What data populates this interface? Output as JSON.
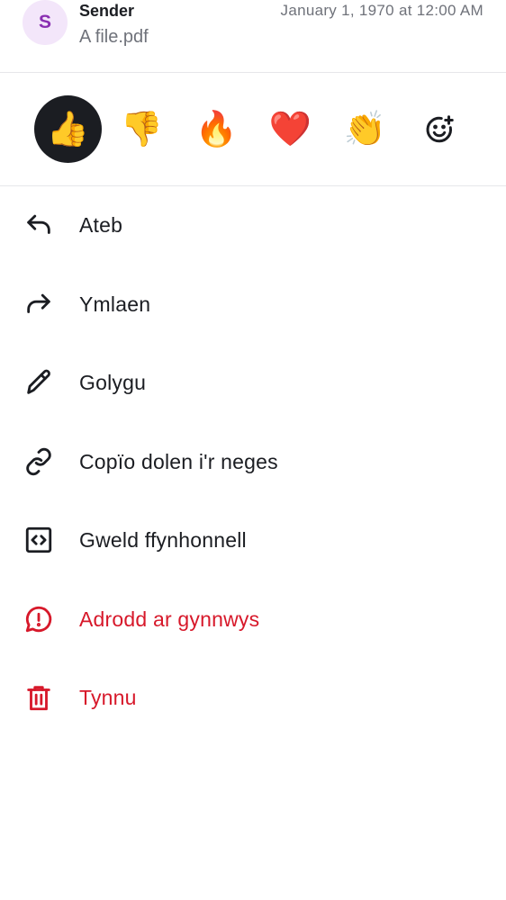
{
  "header": {
    "avatar_initial": "S",
    "sender": "Sender",
    "timestamp": "January 1, 1970 at 12:00 AM",
    "filename": "A file.pdf"
  },
  "reactions": [
    {
      "emoji": "👍",
      "name": "thumbs-up",
      "selected": true
    },
    {
      "emoji": "👎",
      "name": "thumbs-down",
      "selected": false
    },
    {
      "emoji": "🔥",
      "name": "fire",
      "selected": false
    },
    {
      "emoji": "❤️",
      "name": "heart",
      "selected": false
    },
    {
      "emoji": "👏",
      "name": "clapping",
      "selected": false
    },
    {
      "emoji": "",
      "name": "add-reaction-icon",
      "selected": false
    }
  ],
  "menu": {
    "reply": "Ateb",
    "forward": "Ymlaen",
    "edit": "Golygu",
    "copy_link": "Copïo dolen i'r neges",
    "view_source": "Gweld ffynhonnell",
    "report": "Adrodd ar gynnwys",
    "remove": "Tynnu"
  },
  "colors": {
    "danger": "#d7182a",
    "avatar_bg": "#f3e6fa",
    "avatar_fg": "#8a2fb2",
    "selected_bg": "#1b1d22"
  }
}
